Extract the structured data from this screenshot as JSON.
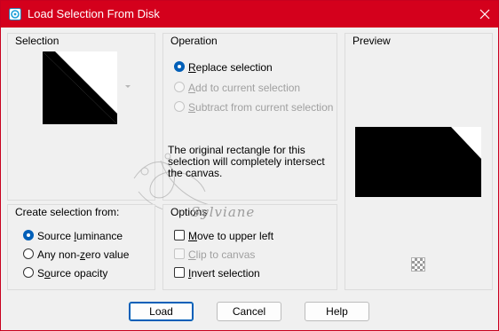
{
  "window": {
    "title": "Load Selection From Disk",
    "close_icon": "close-icon",
    "app_icon": "psp-selection-icon",
    "accent_color": "#d4001c"
  },
  "selection_group": {
    "title": "Selection"
  },
  "operation_group": {
    "title": "Operation",
    "options": [
      {
        "label_pre": "",
        "mnemonic": "R",
        "label_post": "eplace selection",
        "checked": true,
        "enabled": true
      },
      {
        "label_pre": "",
        "mnemonic": "A",
        "label_post": "dd to current selection",
        "checked": false,
        "enabled": false
      },
      {
        "label_pre": "",
        "mnemonic": "S",
        "label_post": "ubtract from current selection",
        "checked": false,
        "enabled": false
      }
    ],
    "info": "The original rectangle for this selection will completely intersect the canvas."
  },
  "preview_group": {
    "title": "Preview",
    "checker_icon": "transparency-checker-icon"
  },
  "create_group": {
    "title": "Create selection from:",
    "options": [
      {
        "label_pre": "Source ",
        "mnemonic": "l",
        "label_post": "uminance",
        "checked": true
      },
      {
        "label_pre": "Any non-",
        "mnemonic": "z",
        "label_post": "ero value",
        "checked": false
      },
      {
        "label_pre": "S",
        "mnemonic": "o",
        "label_post": "urce opacity",
        "checked": false
      }
    ]
  },
  "options_group": {
    "title": "Options",
    "items": [
      {
        "label_pre": "",
        "mnemonic": "M",
        "label_post": "ove to upper left",
        "checked": false,
        "enabled": true
      },
      {
        "label_pre": "",
        "mnemonic": "C",
        "label_post": "lip to canvas",
        "checked": false,
        "enabled": false
      },
      {
        "label_pre": "",
        "mnemonic": "I",
        "label_post": "nvert selection",
        "checked": false,
        "enabled": true
      }
    ]
  },
  "buttons": {
    "load": "Load",
    "cancel": "Cancel",
    "help": "Help"
  },
  "watermark": {
    "text": "Sylviane"
  }
}
